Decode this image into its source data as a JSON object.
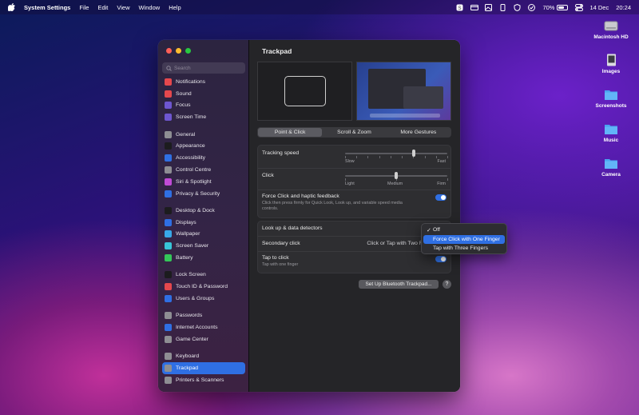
{
  "menubar": {
    "app_name": "System Settings",
    "menus": [
      "File",
      "Edit",
      "View",
      "Window",
      "Help"
    ],
    "battery_percent": "70%",
    "date": "14 Dec",
    "time": "20:24"
  },
  "desktop": {
    "icons": [
      {
        "label": "Macintosh HD",
        "icon": "hard-drive-icon"
      },
      {
        "label": "Images",
        "icon": "document-icon"
      },
      {
        "label": "Screenshots",
        "icon": "folder-icon"
      },
      {
        "label": "Music",
        "icon": "folder-icon"
      },
      {
        "label": "Camera",
        "icon": "folder-icon"
      }
    ]
  },
  "sidebar": {
    "search_placeholder": "Search",
    "groups": [
      [
        {
          "label": "Notifications",
          "color": "#e5484d"
        },
        {
          "label": "Sound",
          "color": "#e5484d"
        },
        {
          "label": "Focus",
          "color": "#6e56cf"
        },
        {
          "label": "Screen Time",
          "color": "#6e56cf"
        }
      ],
      [
        {
          "label": "General",
          "color": "#8e8e93"
        },
        {
          "label": "Appearance",
          "color": "#1c1c1e"
        },
        {
          "label": "Accessibility",
          "color": "#2f6fe3"
        },
        {
          "label": "Control Centre",
          "color": "#8e8e93"
        },
        {
          "label": "Siri & Spotlight",
          "color": "#c04bd6"
        },
        {
          "label": "Privacy & Security",
          "color": "#2f6fe3"
        }
      ],
      [
        {
          "label": "Desktop & Dock",
          "color": "#1c1c1e"
        },
        {
          "label": "Displays",
          "color": "#2f6fe3"
        },
        {
          "label": "Wallpaper",
          "color": "#38a8e8"
        },
        {
          "label": "Screen Saver",
          "color": "#38c5d8"
        },
        {
          "label": "Battery",
          "color": "#34c759"
        }
      ],
      [
        {
          "label": "Lock Screen",
          "color": "#1c1c1e"
        },
        {
          "label": "Touch ID & Password",
          "color": "#e5484d"
        },
        {
          "label": "Users & Groups",
          "color": "#2f6fe3"
        }
      ],
      [
        {
          "label": "Passwords",
          "color": "#8e8e93"
        },
        {
          "label": "Internet Accounts",
          "color": "#2f6fe3"
        },
        {
          "label": "Game Center",
          "color": "#8e8e93"
        }
      ],
      [
        {
          "label": "Keyboard",
          "color": "#8e8e93"
        },
        {
          "label": "Trackpad",
          "color": "#8e8e93",
          "active": true
        },
        {
          "label": "Printers & Scanners",
          "color": "#8e8e93"
        }
      ]
    ]
  },
  "content": {
    "title": "Trackpad",
    "tabs": [
      "Point & Click",
      "Scroll & Zoom",
      "More Gestures"
    ],
    "selected_tab": 0,
    "tracking_speed": {
      "label": "Tracking speed",
      "min_label": "Slow",
      "max_label": "Fast",
      "value_fraction": 0.67
    },
    "click": {
      "label": "Click",
      "labels": [
        "Light",
        "Medium",
        "Firm"
      ],
      "value_fraction": 0.5
    },
    "force_click": {
      "label": "Force Click and haptic feedback",
      "description": "Click then press firmly for Quick Look, Look up, and variable speed media controls.",
      "on": true
    },
    "lookup": {
      "label": "Look up & data detectors"
    },
    "secondary_click": {
      "label": "Secondary click",
      "value": "Click or Tap with Two F"
    },
    "tap_to_click": {
      "label": "Tap to click",
      "description": "Tap with one finger",
      "on": true
    },
    "bt_button": "Set Up Bluetooth Trackpad...",
    "help": "?"
  },
  "popup": {
    "options": [
      "Off",
      "Force Click with One Finger",
      "Tap with Three Fingers"
    ],
    "checked_index": 0,
    "highlighted_index": 1
  }
}
